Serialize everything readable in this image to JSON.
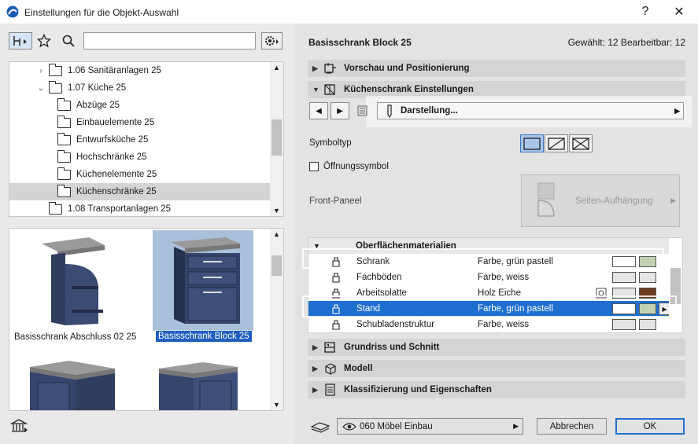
{
  "window": {
    "title": "Einstellungen für die Objekt-Auswahl",
    "help_label": "?",
    "close_label": "✕"
  },
  "library": {
    "tree": [
      {
        "label": "1.06 Sanitäranlagen 25",
        "expanded": false
      },
      {
        "label": "1.07 Küche 25",
        "expanded": true
      },
      {
        "label": "Abzüge 25"
      },
      {
        "label": "Einbauelemente 25"
      },
      {
        "label": "Entwurfsküche 25"
      },
      {
        "label": "Hochschränke 25"
      },
      {
        "label": "Küchenelemente 25"
      },
      {
        "label": "Küchenschränke 25",
        "selected": true
      },
      {
        "label": "1.08 Transportanlagen 25"
      }
    ],
    "items": [
      {
        "label": "Basisschrank Abschluss 02 25"
      },
      {
        "label": "Basisschrank Block 25",
        "selected": true
      }
    ]
  },
  "header": {
    "object_name": "Basisschrank Block 25",
    "selection_count": "Gewählt: 12 Bearbeitbar: 12"
  },
  "panels": {
    "preview": "Vorschau und Positionierung",
    "settings": "Küchenschrank Einstellungen",
    "floorplan": "Grundriss und Schnitt",
    "model": "Modell",
    "classification": "Klassifizierung und Eigenschaften"
  },
  "settings": {
    "page_dropdown": "Darstellung...",
    "symboltyp_label": "Symboltyp",
    "opening_symbol_label": "Öffnungssymbol",
    "front_panel_label": "Front-Paneel",
    "front_panel_value": "Seiten-Aufhängung"
  },
  "materials": {
    "header": "Oberflächenmaterialien",
    "rows": [
      {
        "name": "Schrank",
        "value": "Farbe, grün pastell",
        "color_a": "#ffffff",
        "color_b": "#c2d3b4"
      },
      {
        "name": "Fachböden",
        "value": "Farbe, weiss",
        "color_a": "#e4e4e4",
        "color_b": "#e4e4e4"
      },
      {
        "name": "Arbeitsplatte",
        "value": "Holz Eiche",
        "color_a": "#e4e4e4",
        "color_b": "#6e3c22",
        "has_link": true
      },
      {
        "name": "Stand",
        "value": "Farbe, grün pastell",
        "color_a": "#ffffff",
        "color_b": "#c2d3b4",
        "selected": true
      },
      {
        "name": "Schubladenstruktur",
        "value": "Farbe, weiss",
        "color_a": "#e4e4e4",
        "color_b": "#e4e4e4"
      }
    ]
  },
  "footer": {
    "layer_value": "060 Möbel Einbau",
    "cancel_label": "Abbrechen",
    "ok_label": "OK"
  },
  "colors": {
    "accent": "#1f6fd1",
    "selection_blue": "#1f5fbf"
  }
}
